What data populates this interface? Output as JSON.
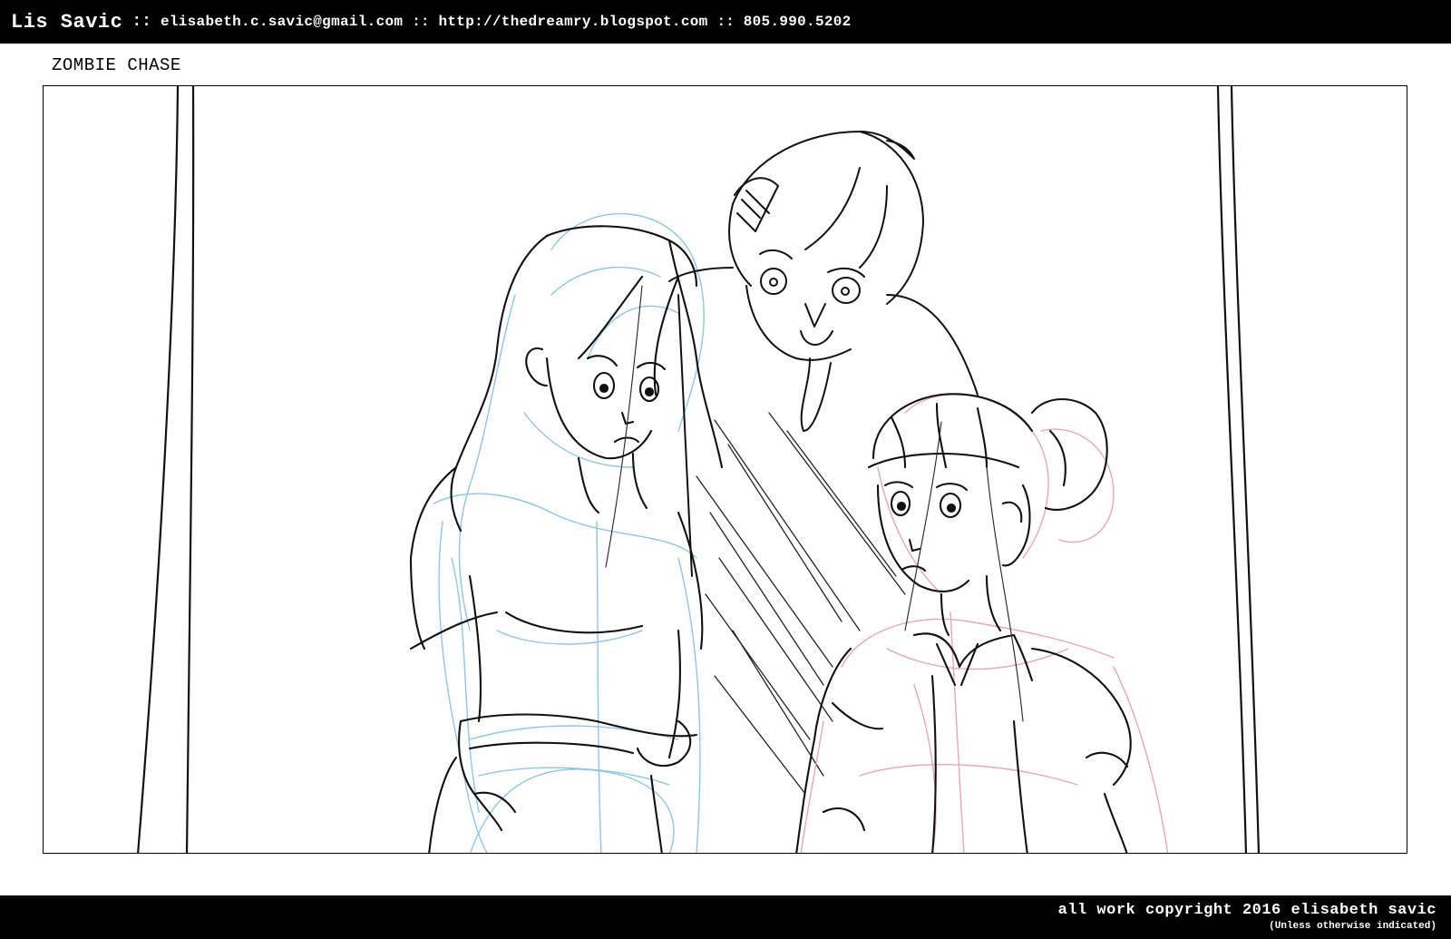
{
  "header": {
    "artist_name": "Lis Savic",
    "separator": "::",
    "email": "elisabeth.c.savic@gmail.com",
    "website": "http://thedreamry.blogspot.com",
    "phone": "805.990.5202"
  },
  "panel": {
    "title": "ZOMBIE CHASE"
  },
  "footer": {
    "copyright": "all work copyright 2016 elisabeth savic",
    "note": "(Unless otherwise indicated)"
  },
  "colors": {
    "bar_background": "#000000",
    "bar_text": "#ffffff",
    "ink": "#111111",
    "blue_construction": "#8ec6e6",
    "pink_construction": "#e9a3c3"
  }
}
